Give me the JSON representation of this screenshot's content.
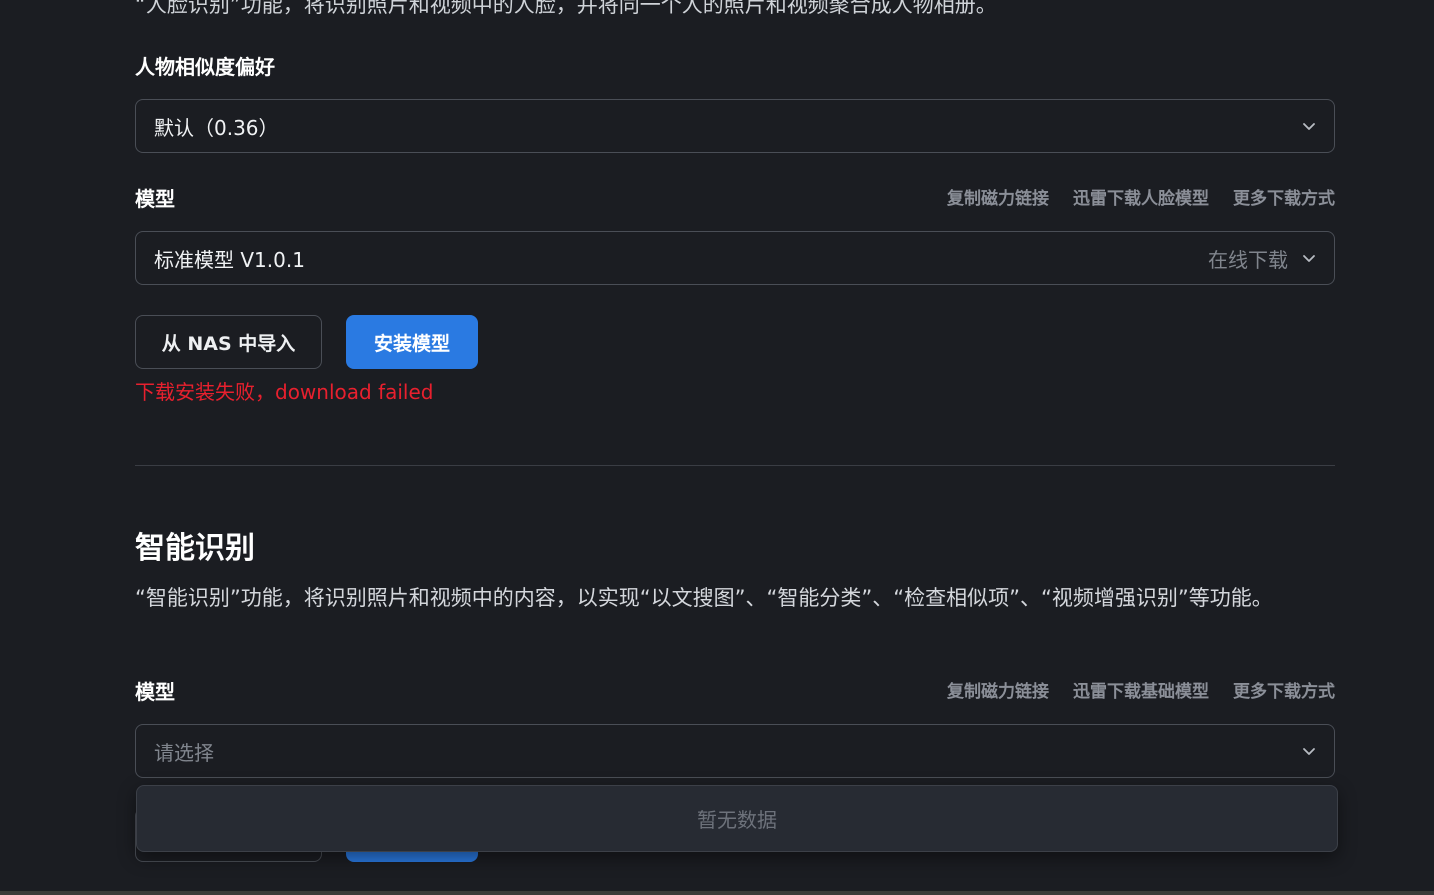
{
  "face": {
    "intro": "“人脸识别”功能，将识别照片和视频中的人脸，并将同一个人的照片和视频聚合成人物相册。",
    "similarity_label": "人物相似度偏好",
    "similarity_value": "默认（0.36）",
    "model_label": "模型",
    "links": [
      "复制磁力链接",
      "迅雷下载人脸模型",
      "更多下载方式"
    ],
    "model_value": "标准模型 V1.0.1",
    "model_source": "在线下载",
    "import_button": "从 NAS 中导入",
    "install_button": "安装模型",
    "error": "下载安装失败，download failed"
  },
  "smart": {
    "title": "智能识别",
    "description": "“智能识别”功能，将识别照片和视频中的内容，以实现“以文搜图”、“智能分类”、“检查相似项”、“视频增强识别”等功能。",
    "model_label": "模型",
    "links": [
      "复制磁力链接",
      "迅雷下载基础模型",
      "更多下载方式"
    ],
    "model_placeholder": "请选择",
    "dropdown_empty": "暂无数据"
  },
  "colors": {
    "background": "#1b1d22",
    "primary": "#2a7ae2",
    "error": "#e8202e"
  }
}
